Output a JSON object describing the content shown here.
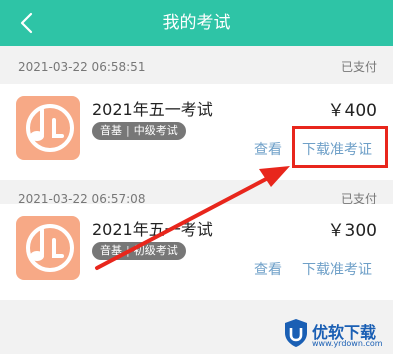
{
  "header": {
    "title": "我的考试"
  },
  "orders": [
    {
      "time": "2021-03-22 06:58:51",
      "status": "已支付",
      "name": "2021年五一考试",
      "tag1": "音基",
      "tag2": "中级考试",
      "price": "￥400",
      "view_label": "查看",
      "download_label": "下载准考证"
    },
    {
      "time": "2021-03-22 06:57:08",
      "status": "已支付",
      "name": "2021年五一考试",
      "tag1": "音基",
      "tag2": "初级考试",
      "price": "￥300",
      "view_label": "查看",
      "download_label": "下载准考证"
    }
  ],
  "watermark": {
    "brand": "优软下载",
    "url": "www.yrdown.com"
  },
  "colors": {
    "header": "#2ec4a6",
    "link": "#6fa0c8",
    "highlight": "#e8261c",
    "thumb": "#f7a986"
  }
}
